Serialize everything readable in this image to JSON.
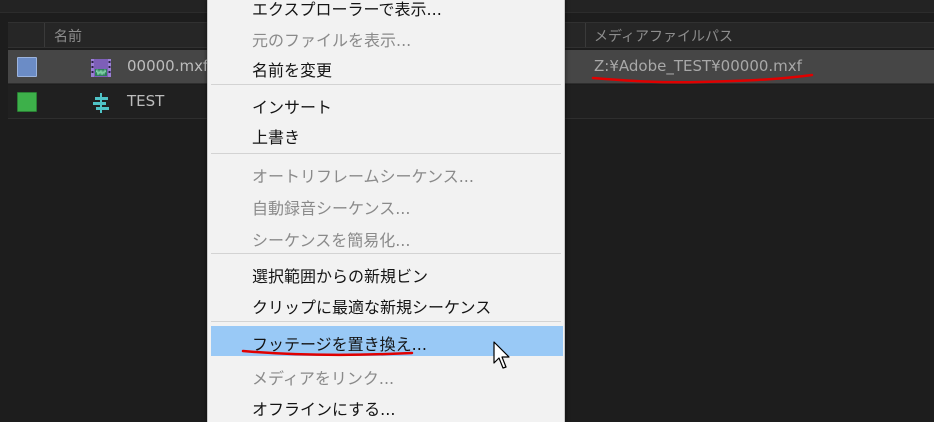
{
  "table": {
    "headers": {
      "name": "名前",
      "media_path": "メディアファイルパス"
    },
    "rows": [
      {
        "name": "00000.mxf",
        "path": "Z:¥Adobe_TEST¥00000.mxf",
        "swatch_color": "#6b8cc6",
        "icon": "video-clip-icon"
      },
      {
        "name": "TEST",
        "path": "",
        "swatch_color": "#3db04a",
        "icon": "sequence-icon"
      }
    ]
  },
  "context_menu": {
    "items": [
      {
        "label": "エクスプローラーで表示...",
        "enabled": true
      },
      {
        "label": "元のファイルを表示...",
        "enabled": false
      },
      {
        "label": "名前を変更",
        "enabled": true
      },
      {
        "label": "インサート",
        "enabled": true
      },
      {
        "label": "上書き",
        "enabled": true
      },
      {
        "label": "オートリフレームシーケンス...",
        "enabled": false
      },
      {
        "label": "自動録音シーケンス...",
        "enabled": false
      },
      {
        "label": "シーケンスを簡易化...",
        "enabled": false
      },
      {
        "label": "選択範囲からの新規ビン",
        "enabled": true
      },
      {
        "label": "クリップに最適な新規シーケンス",
        "enabled": true
      },
      {
        "label": "フッテージを置き換え...",
        "enabled": true,
        "highlighted": true
      },
      {
        "label": "メディアをリンク...",
        "enabled": false
      },
      {
        "label": "オフラインにする...",
        "enabled": true
      }
    ]
  },
  "colors": {
    "highlight": "#99c9f6",
    "annotation": "#e00000"
  }
}
